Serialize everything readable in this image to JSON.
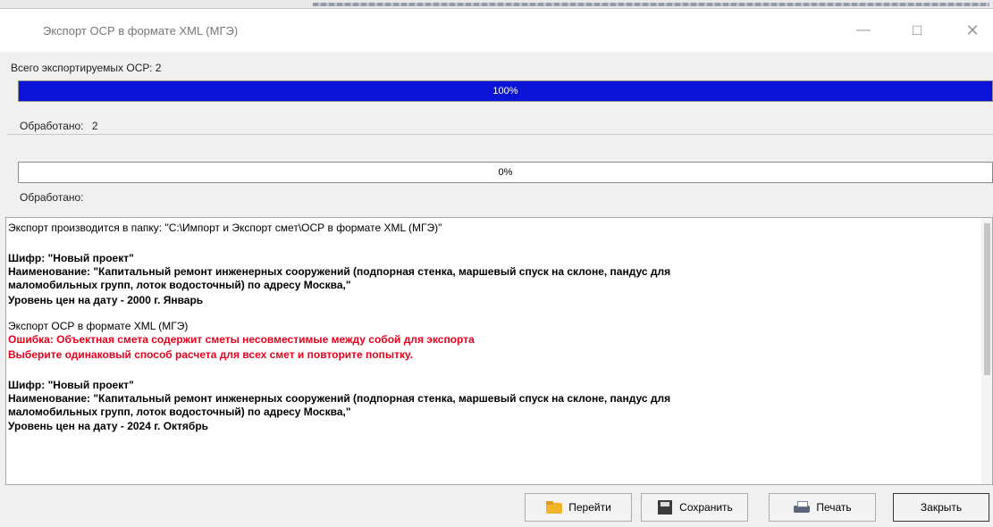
{
  "window": {
    "title": "Экспорт ОСР в формате XML (МГЭ)",
    "controls": {
      "minimize": "—",
      "maximize": "☐",
      "close": "✕"
    }
  },
  "progress1": {
    "total_label": "Всего экспортируемых ОСР: 2",
    "percent_text": "100%",
    "fraction": 1.0,
    "processed_label": "Обработано:",
    "processed_value": "2"
  },
  "progress2": {
    "percent_text": "0%",
    "fraction": 0.0,
    "processed_label": "Обработано:"
  },
  "log": {
    "line1": "Экспорт производится в папку: \"C:\\Импорт и Экспорт смет\\ОСР в формате XML (МГЭ)\"",
    "block1": {
      "code": "Шифр: \"Новый проект\"",
      "name1": "Наименование: \"Капитальный ремонт инженерных сооружений (подпорная стенка, маршевый спуск на склоне, пандус для",
      "name2": "маломобильных групп, лоток водосточный) по адресу Москва,\"",
      "level": "Уровень цен на дату - 2000 г. Январь"
    },
    "export_line": "Экспорт ОСР в формате XML (МГЭ)",
    "error1": "Ошибка: Объектная смета содержит сметы несовместимые между собой для экспорта",
    "error2": "Выберите одинаковый способ расчета для всех смет и повторите попытку.",
    "block2": {
      "code": "Шифр: \"Новый проект\"",
      "name1": "Наименование: \"Капитальный ремонт инженерных сооружений (подпорная стенка, маршевый спуск на склоне, пандус для",
      "name2": "маломобильных групп, лоток водосточный) по адресу Москва,\"",
      "level": "Уровень цен на дату - 2024 г. Октябрь"
    }
  },
  "buttons": {
    "goto": "Перейти",
    "save": "Сохранить",
    "print": "Печать",
    "close": "Закрыть"
  },
  "colors": {
    "progress_fill": "#0b14d6",
    "error_text": "#e8001c"
  }
}
